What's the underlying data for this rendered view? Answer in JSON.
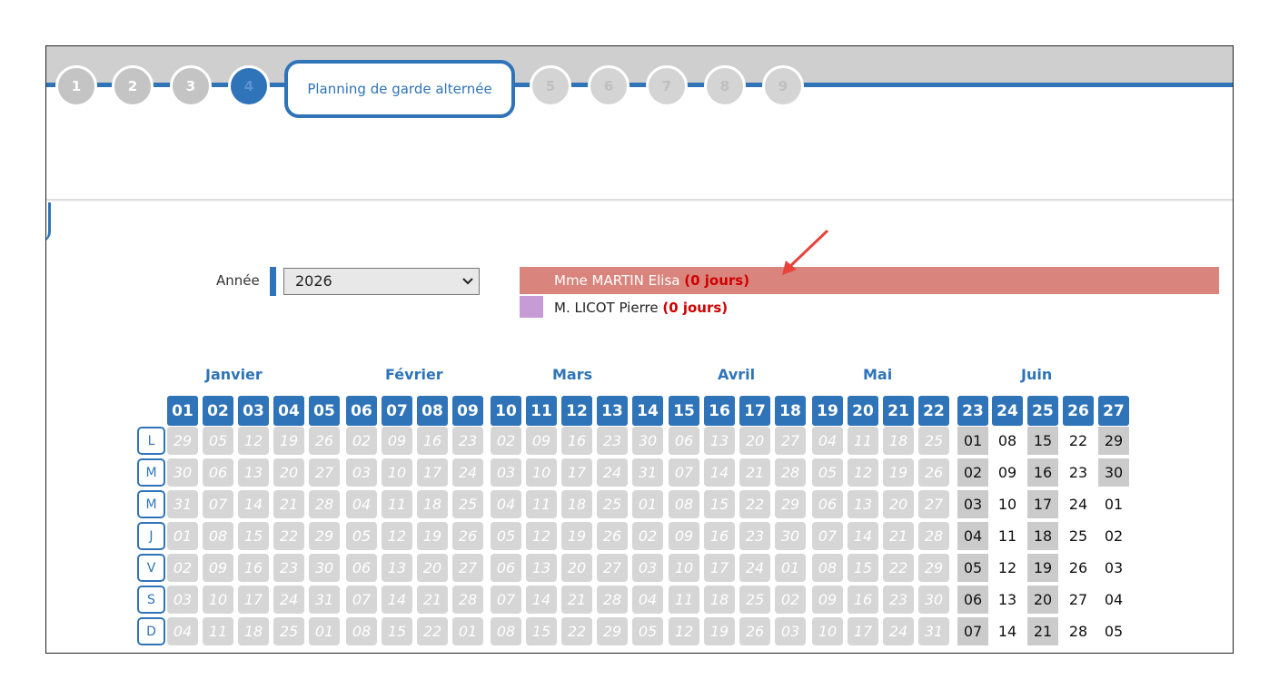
{
  "wizard": {
    "steps": [
      "1",
      "2",
      "3",
      "4",
      "5",
      "6",
      "7",
      "8",
      "9"
    ],
    "current_label": "Planning de garde alternée"
  },
  "year": {
    "label": "Année",
    "value": "2026"
  },
  "legend": [
    {
      "name": "Mme MARTIN Elisa",
      "days": "(0 jours)",
      "color": "#d9847c"
    },
    {
      "name": "M. LICOT Pierre",
      "days": "(0 jours)",
      "color": "#c69bd6"
    }
  ],
  "calendar": {
    "months": [
      "Janvier",
      "Février",
      "Mars",
      "Avril",
      "Mai",
      "Juin"
    ],
    "weekday_labels": [
      "L",
      "M",
      "M",
      "J",
      "V",
      "S",
      "D"
    ],
    "weeks": [
      {
        "num": "01",
        "days": [
          "29",
          "30",
          "31",
          "01",
          "02",
          "03",
          "04"
        ]
      },
      {
        "num": "02",
        "days": [
          "05",
          "06",
          "07",
          "08",
          "09",
          "10",
          "11"
        ]
      },
      {
        "num": "03",
        "days": [
          "12",
          "13",
          "14",
          "15",
          "16",
          "17",
          "18"
        ]
      },
      {
        "num": "04",
        "days": [
          "19",
          "20",
          "21",
          "22",
          "23",
          "24",
          "25"
        ]
      },
      {
        "num": "05",
        "days": [
          "26",
          "27",
          "28",
          "29",
          "30",
          "31",
          "01"
        ]
      },
      {
        "num": "06",
        "days": [
          "02",
          "03",
          "04",
          "05",
          "06",
          "07",
          "08"
        ]
      },
      {
        "num": "07",
        "days": [
          "09",
          "10",
          "11",
          "12",
          "13",
          "14",
          "15"
        ]
      },
      {
        "num": "08",
        "days": [
          "16",
          "17",
          "18",
          "19",
          "20",
          "21",
          "22"
        ]
      },
      {
        "num": "09",
        "days": [
          "23",
          "24",
          "25",
          "26",
          "27",
          "28",
          "01"
        ]
      },
      {
        "num": "10",
        "days": [
          "02",
          "03",
          "04",
          "05",
          "06",
          "07",
          "08"
        ]
      },
      {
        "num": "11",
        "days": [
          "09",
          "10",
          "11",
          "12",
          "13",
          "14",
          "15"
        ]
      },
      {
        "num": "12",
        "days": [
          "16",
          "17",
          "18",
          "19",
          "20",
          "21",
          "22"
        ]
      },
      {
        "num": "13",
        "days": [
          "23",
          "24",
          "25",
          "26",
          "27",
          "28",
          "29"
        ]
      },
      {
        "num": "14",
        "days": [
          "30",
          "31",
          "01",
          "02",
          "03",
          "04",
          "05"
        ]
      },
      {
        "num": "15",
        "days": [
          "06",
          "07",
          "08",
          "09",
          "10",
          "11",
          "12"
        ]
      },
      {
        "num": "16",
        "days": [
          "13",
          "14",
          "15",
          "16",
          "17",
          "18",
          "19"
        ]
      },
      {
        "num": "17",
        "days": [
          "20",
          "21",
          "22",
          "23",
          "24",
          "25",
          "26"
        ]
      },
      {
        "num": "18",
        "days": [
          "27",
          "28",
          "29",
          "30",
          "01",
          "02",
          "03"
        ]
      },
      {
        "num": "19",
        "days": [
          "04",
          "05",
          "06",
          "07",
          "08",
          "09",
          "10"
        ]
      },
      {
        "num": "20",
        "days": [
          "11",
          "12",
          "13",
          "14",
          "15",
          "16",
          "17"
        ]
      },
      {
        "num": "21",
        "days": [
          "18",
          "19",
          "20",
          "21",
          "22",
          "23",
          "24"
        ]
      },
      {
        "num": "22",
        "days": [
          "25",
          "26",
          "27",
          "28",
          "29",
          "30",
          "31"
        ]
      },
      {
        "num": "23",
        "days": [
          "01",
          "02",
          "03",
          "04",
          "05",
          "06",
          "07"
        ]
      },
      {
        "num": "24",
        "days": [
          "08",
          "09",
          "10",
          "11",
          "12",
          "13",
          "14"
        ]
      },
      {
        "num": "25",
        "days": [
          "15",
          "16",
          "17",
          "18",
          "19",
          "20",
          "21"
        ]
      },
      {
        "num": "26",
        "days": [
          "22",
          "23",
          "24",
          "25",
          "26",
          "27",
          "28"
        ]
      },
      {
        "num": "27",
        "days": [
          "29",
          "30",
          "01",
          "02",
          "03",
          "04",
          "05"
        ]
      }
    ]
  },
  "colors": {
    "accent": "#2f74b8",
    "past_day": "#d6d6d6",
    "open_day": "#cbcbcb",
    "days_text": "#d00000"
  }
}
